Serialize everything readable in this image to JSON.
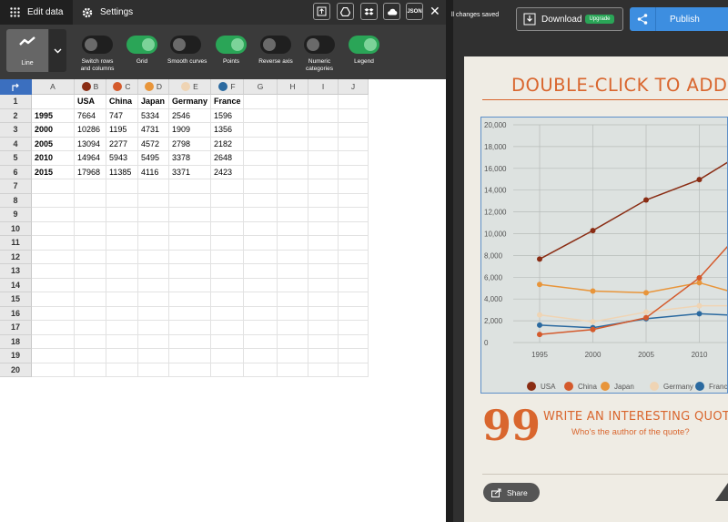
{
  "topbar": {
    "edit_data_label": "Edit data",
    "settings_label": "Settings",
    "json_label": "JSON",
    "close_label": "✕"
  },
  "options": {
    "chart_type_label": "Line",
    "toggles": [
      {
        "label_line1": "Switch rows",
        "label_line2": "and columns",
        "on": false
      },
      {
        "label_line1": "Grid",
        "label_line2": "",
        "on": true
      },
      {
        "label_line1": "Smooth curves",
        "label_line2": "",
        "on": false
      },
      {
        "label_line1": "Points",
        "label_line2": "",
        "on": true
      },
      {
        "label_line1": "Reverse axis",
        "label_line2": "",
        "on": false
      },
      {
        "label_line1": "Numeric",
        "label_line2": "categories",
        "on": false
      },
      {
        "label_line1": "Legend",
        "label_line2": "",
        "on": true
      }
    ]
  },
  "sheet": {
    "columns": [
      "A",
      "B",
      "C",
      "D",
      "E",
      "F",
      "G",
      "H",
      "I",
      "J"
    ],
    "column_dot_colors": [
      "",
      "#8a2d14",
      "#d45a2c",
      "#e8953a",
      "#efd4b4",
      "#2b6aa0",
      "",
      "",
      "",
      ""
    ],
    "row_numbers": [
      "1",
      "2",
      "3",
      "4",
      "5",
      "6",
      "7",
      "8",
      "9",
      "10",
      "11",
      "12",
      "13",
      "14",
      "15",
      "16",
      "17",
      "18",
      "19",
      "20"
    ],
    "rows": [
      [
        "",
        "USA",
        "China",
        "Japan",
        "Germany",
        "France"
      ],
      [
        "1995",
        "7664",
        "747",
        "5334",
        "2546",
        "1596"
      ],
      [
        "2000",
        "10286",
        "1195",
        "4731",
        "1909",
        "1356"
      ],
      [
        "2005",
        "13094",
        "2277",
        "4572",
        "2798",
        "2182"
      ],
      [
        "2010",
        "14964",
        "5943",
        "5495",
        "3378",
        "2648"
      ],
      [
        "2015",
        "17968",
        "11385",
        "4116",
        "3371",
        "2423"
      ]
    ]
  },
  "header": {
    "saved_text": "ll changes saved",
    "download_label": "Download",
    "upgrade_label": "Upgrade",
    "publish_label": "Publish"
  },
  "infographic": {
    "title": "DOUBLE-CLICK TO ADD TIT",
    "quote_mark": "99",
    "quote": "WRITE AN INTERESTING QUOTE",
    "quote_author": "Who's the author of the quote?",
    "share_label": "Share"
  },
  "chart_data": {
    "type": "line",
    "x": [
      1995,
      2000,
      2005,
      2010,
      2015
    ],
    "series": [
      {
        "name": "USA",
        "color": "#8a2d14",
        "values": [
          7664,
          10286,
          13094,
          14964,
          17968
        ]
      },
      {
        "name": "China",
        "color": "#d45a2c",
        "values": [
          747,
          1195,
          2277,
          5943,
          11385
        ]
      },
      {
        "name": "Japan",
        "color": "#e8953a",
        "values": [
          5334,
          4731,
          4572,
          5495,
          4116
        ]
      },
      {
        "name": "Germany",
        "color": "#efd4b4",
        "values": [
          2546,
          1909,
          2798,
          3378,
          3371
        ]
      },
      {
        "name": "France",
        "color": "#2b6aa0",
        "values": [
          1596,
          1356,
          2182,
          2648,
          2423
        ]
      }
    ],
    "visible_x_ticks": [
      "1995",
      "2000",
      "2005",
      "2010"
    ],
    "y_ticks": [
      "0",
      "2,000",
      "4,000",
      "6,000",
      "8,000",
      "10,000",
      "12,000",
      "14,000",
      "16,000",
      "18,000",
      "20,000"
    ],
    "ylim": [
      0,
      20000
    ],
    "grid": true,
    "legend_labels": [
      "USA",
      "China",
      "Japan",
      "Germany",
      "Franc"
    ],
    "legend_position": "bottom"
  }
}
